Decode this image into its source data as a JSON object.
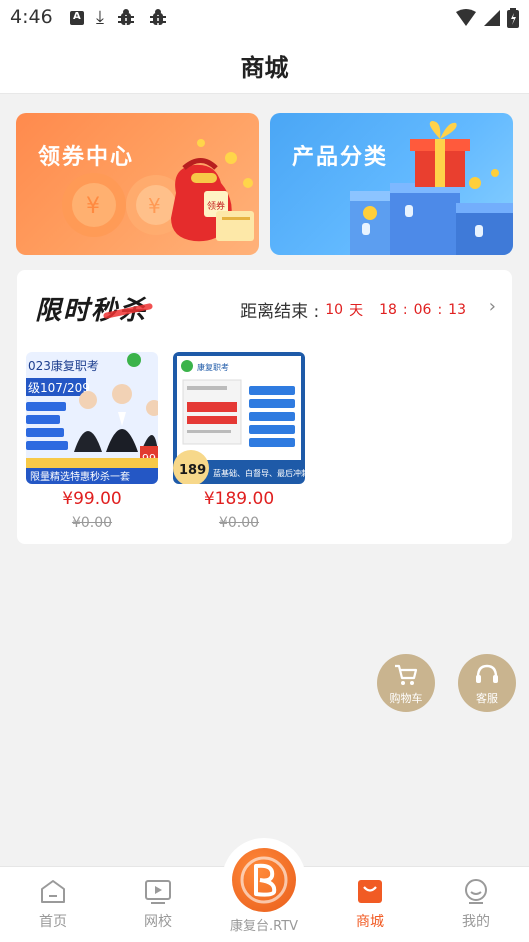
{
  "status_bar": {
    "time": "4:46"
  },
  "header": {
    "title": "商城"
  },
  "banners": [
    {
      "label": "领券中心",
      "badge": "领券"
    },
    {
      "label": "产品分类"
    }
  ],
  "flash_sale": {
    "title": "限时秒杀",
    "countdown_label": "距离结束 :",
    "days": "10",
    "days_unit": "天",
    "hours": "18",
    "minutes": "06",
    "seconds": "13",
    "sep": ":",
    "products": [
      {
        "thumb_line1": "023康复职考",
        "thumb_line2": "级107/209",
        "thumb_tag": "限量精选特惠秒杀一套",
        "price": "¥99.00",
        "original": "¥0.00",
        "badge": "99"
      },
      {
        "thumb_line1": "康复职考",
        "thumb_tag": "蓝基础、白督导、最后冲刺",
        "price": "¥189.00",
        "original": "¥0.00",
        "badge": "189"
      }
    ]
  },
  "floating": {
    "cart_label": "购物车",
    "service_label": "客服",
    "color": "#c9b48f"
  },
  "tabbar": {
    "items": [
      {
        "label": "首页",
        "icon": "home-icon"
      },
      {
        "label": "网校",
        "icon": "video-icon"
      },
      {
        "label": "康复台.RTV",
        "icon": "brand-logo"
      },
      {
        "label": "商城",
        "icon": "shop-bag-icon",
        "active": true
      },
      {
        "label": "我的",
        "icon": "profile-icon"
      }
    ],
    "active_color": "#f15b24",
    "inactive_color": "#999999"
  }
}
